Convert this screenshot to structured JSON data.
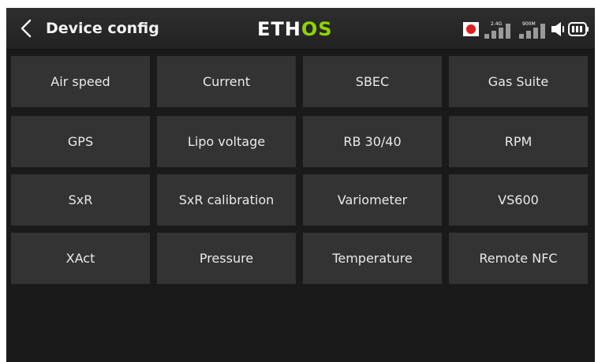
{
  "header": {
    "back_icon": "chevron-left-icon",
    "title": "Device config",
    "logo_primary": "ETH",
    "logo_accent": "OS",
    "logo_accent_color": "#8fd400",
    "status": {
      "record_icon": "record-icon",
      "record_color": "#e11d1d",
      "signal_1_label": "2.4G",
      "signal_2_label": "900M",
      "volume_icon": "speaker-icon",
      "battery_icon": "battery-icon"
    }
  },
  "devices": [
    [
      "Air speed",
      "Current",
      "SBEC",
      "Gas Suite"
    ],
    [
      "GPS",
      "Lipo voltage",
      "RB 30/40",
      "RPM"
    ],
    [
      "SxR",
      "SxR calibration",
      "Variometer",
      "VS600"
    ],
    [
      "XAct",
      "Pressure",
      "Temperature",
      "Remote NFC"
    ]
  ],
  "colors": {
    "background": "#1a1a1a",
    "tile": "#333333",
    "header": "#262626",
    "text": "#e9e9e9"
  }
}
